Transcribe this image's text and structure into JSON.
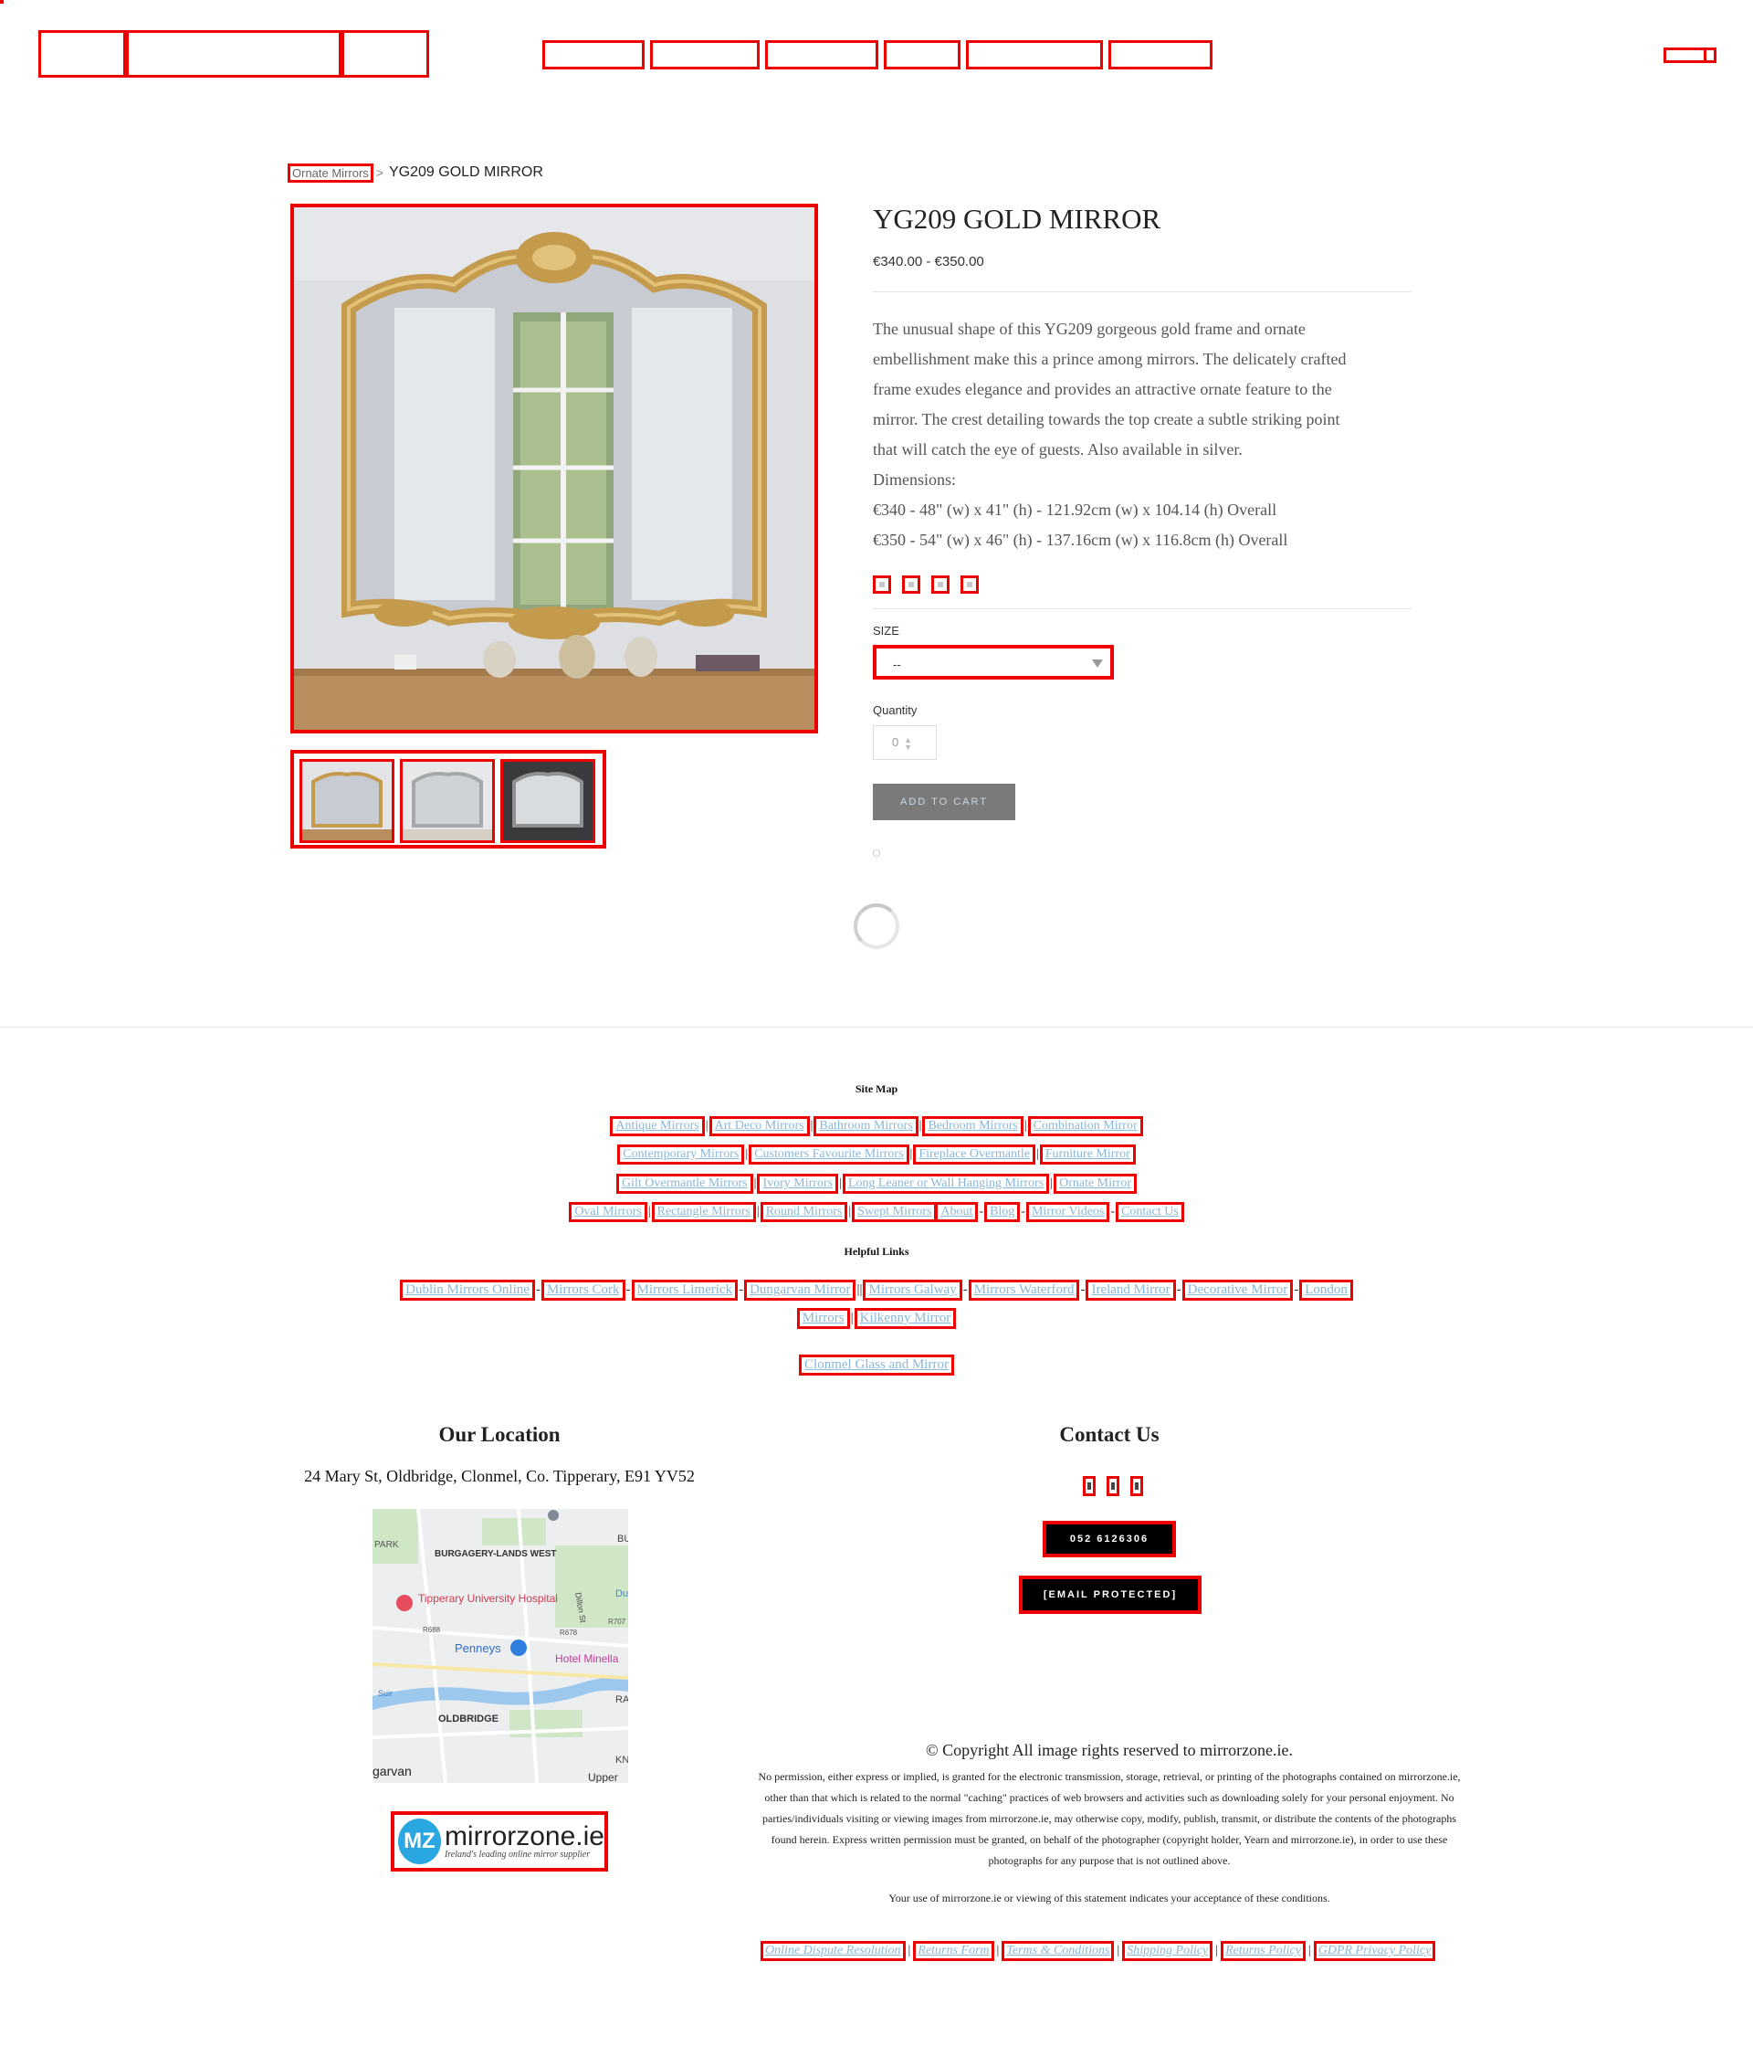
{
  "breadcrumb": {
    "parent": "Ornate Mirrors",
    "separator": ">",
    "current": "YG209 GOLD MIRROR"
  },
  "product": {
    "title": "YG209 GOLD MIRROR",
    "price": "€340.00 - €350.00",
    "description": [
      "The unusual shape of this YG209 gorgeous gold frame and ornate",
      "embellishment make this a prince among mirrors. The delicately crafted",
      "frame exudes elegance and provides an attractive ornate feature to the",
      "mirror. The crest detailing towards the top create a subtle striking point",
      "that will catch the eye of guests. Also available in silver.",
      "Dimensions:",
      "€340 - 48\" (w) x 41\" (h) - 121.92cm (w) x 104.14 (h) Overall",
      "€350 - 54\" (w) x 46\" (h) - 137.16cm (w) x 116.8cm (h) Overall"
    ],
    "size_label": "SIZE",
    "size_value": "--",
    "quantity_label": "Quantity",
    "quantity_value": "0",
    "add_to_cart": "ADD TO CART"
  },
  "footer": {
    "site_map_title": "Site Map",
    "site_map_rows": [
      [
        "Antique Mirrors",
        "Art Deco Mirrors",
        "Bathroom Mirrors",
        "Bedroom Mirrors",
        "Combination Mirror"
      ],
      [
        "Contemporary Mirrors",
        "Customers Favourite Mirrors",
        "Fireplace Overmantle",
        "Furniture Mirror"
      ],
      [
        "Gilt Overmantle Mirrors",
        "Ivory Mirrors",
        "Long Leaner or Wall Hanging Mirrors",
        "Ornate Mirror"
      ],
      [
        "Oval Mirrors",
        "Rectangle Mirrors",
        "Round Mirrors",
        "Swept Mirrors",
        "About",
        "Blog",
        "Mirror Videos",
        "Contact Us"
      ]
    ],
    "helpful_title": "Helpful Links",
    "helpful_row1": [
      "Dublin Mirrors Online",
      "Mirrors Cork",
      "Mirrors Limerick",
      "Dungarvan Mirror",
      "Mirrors Galway",
      "Mirrors Waterford",
      "Ireland Mirror",
      "Decorative Mirror",
      "London"
    ],
    "helpful_row2": [
      "Mirrors",
      "Kilkenny Mirror"
    ],
    "helpful_row3": [
      "Clonmel Glass and Mirror"
    ],
    "location_title": "Our Location",
    "address": "24 Mary St, Oldbridge, Clonmel, Co. Tipperary, E91 YV52",
    "map_labels": [
      "PARK",
      "BURGAGERY-LANDS WEST",
      "Tipperary University Hospital",
      "Penneys",
      "Hotel Minella",
      "OLDBRIDGE",
      "garvan",
      "Suir",
      "Upper",
      "R688",
      "R678",
      "R707",
      "BU",
      "Du",
      "RA",
      "KN",
      "Dillon St"
    ],
    "logo_text": "mirrorzone.ie",
    "logo_tagline": "Ireland's leading online mirror supplier",
    "logo_mark": "MZ",
    "contact_title": "Contact Us",
    "phone": "052 6126306",
    "email": "[EMAIL PROTECTED]",
    "copyright_title": "© Copyright All image rights reserved to mirrorzone.ie.",
    "copyright_body": "No permission, either express or implied, is granted for the electronic transmission, storage, retrieval, or printing of the photographs contained on mirrorzone.ie, other than that which is related to the normal \"caching\" practices of web browsers and activities such as downloading solely for your personal enjoyment. No parties/individuals visiting or viewing images from mirrorzone.ie, may otherwise copy, modify, publish, transmit, or distribute the contents of the photographs found herein. Express written permission must be granted, on behalf of the photographer (copyright holder, Yearn and mirrorzone.ie), in order to use these photographs for any purpose that is not outlined above.",
    "copyright_note": "Your use of mirrorzone.ie or viewing of this statement indicates your acceptance of these conditions.",
    "legal_links": [
      "Online Dispute Resolution",
      "Returns Form",
      "Terms & Conditions",
      "Shipping Policy",
      "Returns Policy",
      "GDPR Privacy Policy"
    ]
  },
  "colors": {
    "link": "#8bb7d8",
    "highlight": "#e00000",
    "button_bg": "#7a7a7a",
    "contact_btn": "#000000",
    "logo_blue": "#2aa6e0"
  }
}
